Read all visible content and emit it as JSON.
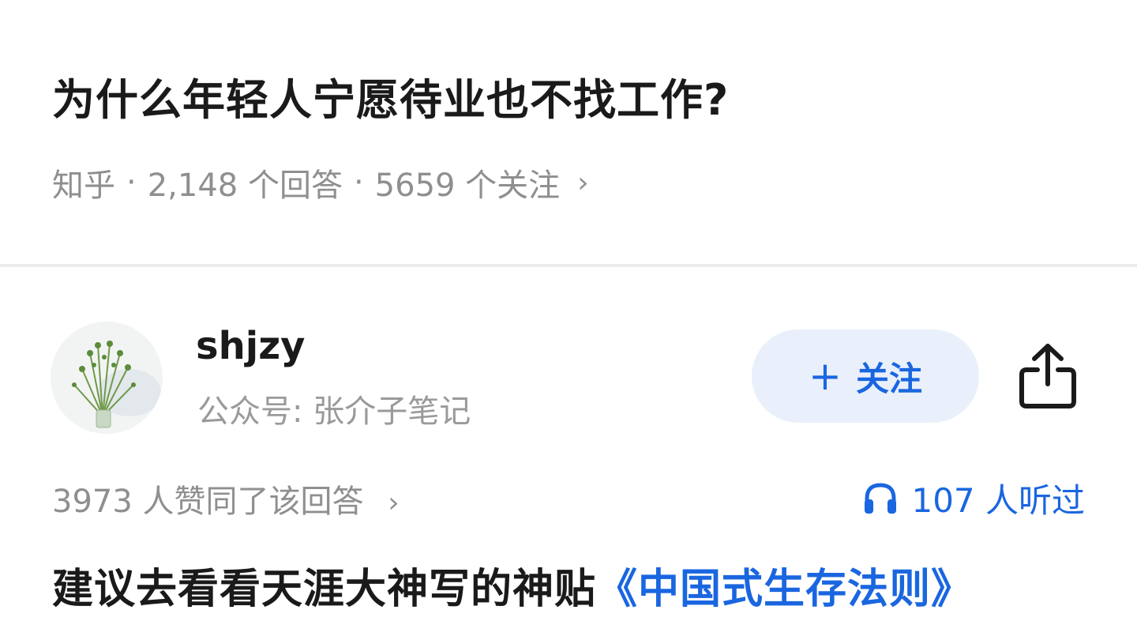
{
  "question": {
    "title": "为什么年轻人宁愿待业也不找工作?",
    "source": "知乎",
    "separator": "·",
    "answers": "2,148 个回答",
    "followers": "5659 个关注",
    "chevron": "›"
  },
  "answer": {
    "author": {
      "name": "shjzy",
      "bio": "公众号: 张介子笔记"
    },
    "follow_button": {
      "plus": "+",
      "label": "关注"
    },
    "share_icon": "share-icon",
    "votes": "3973 人赞同了该回答",
    "votes_chevron": "›",
    "listen_count": "107 人听过",
    "listen_icon": "headphones-icon",
    "body_text": "建议去看看天涯大神写的神贴",
    "body_link": "《中国式生存法则》"
  },
  "colors": {
    "link": "#1a66e0",
    "follow_bg": "#e9f0fb",
    "meta_text": "#8f8f8f",
    "title_text": "#1a1a1a"
  }
}
